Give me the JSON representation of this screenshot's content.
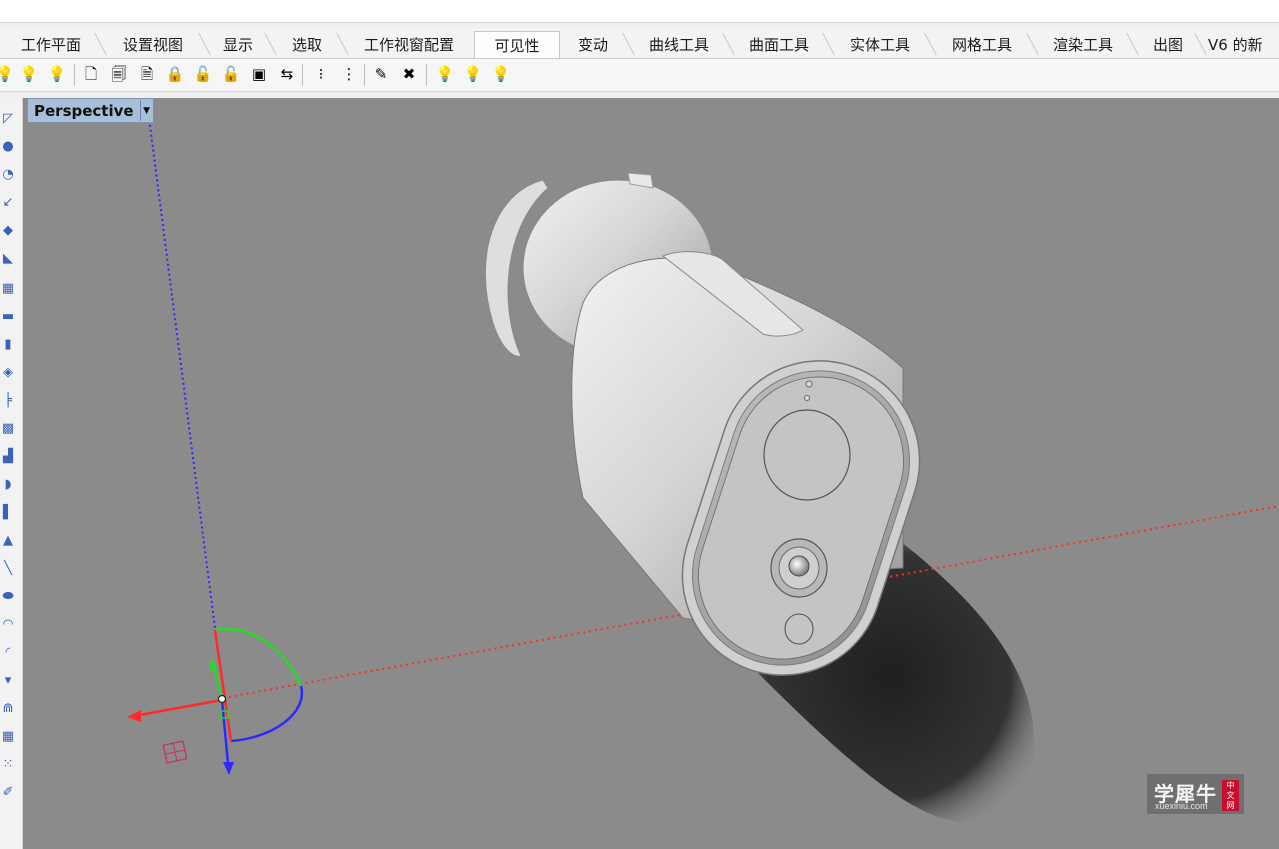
{
  "tabs": [
    {
      "label": "工作平面"
    },
    {
      "label": "设置视图"
    },
    {
      "label": "显示"
    },
    {
      "label": "选取"
    },
    {
      "label": "工作视窗配置"
    },
    {
      "label": "可见性",
      "active": true
    },
    {
      "label": "变动"
    },
    {
      "label": "曲线工具"
    },
    {
      "label": "曲面工具"
    },
    {
      "label": "实体工具"
    },
    {
      "label": "网格工具"
    },
    {
      "label": "渲染工具"
    },
    {
      "label": "出图"
    },
    {
      "label": "V6 的新"
    }
  ],
  "toolbar_icons": [
    "show-light-icon",
    "show-selected-light-icon",
    "hide-light-icon",
    "lock-object-icon",
    "lock-selected-icon",
    "unlock-selected-icon",
    "padlock-icon",
    "padlock-open-icon",
    "padlock-partial-icon",
    "lock-swap-icon",
    "swap-visibility-icon",
    "show-points-icon",
    "hide-points-icon",
    "show-edges-icon",
    "hide-edges-icon",
    "lightbulb-on-icon",
    "lightbulb-selected-icon",
    "lightbulb-off-icon"
  ],
  "left_tools": [
    "point-icon",
    "circle-icon",
    "arc-icon",
    "curve-icon",
    "polyline-icon",
    "line-icon",
    "rectangle-icon",
    "polygon-icon",
    "surface-icon",
    "extrude-icon",
    "loft-icon",
    "patch-icon",
    "box-icon",
    "sphere-icon",
    "cylinder-icon",
    "cone-icon",
    "pipe-icon",
    "ellipsoid-icon",
    "torus-icon",
    "boolean-icon",
    "fillet-icon",
    "mesh-icon",
    "grid-icon",
    "analysis-icon"
  ],
  "viewport": {
    "title": "Perspective",
    "background": "#8b8b8b"
  },
  "colors": {
    "x_axis": "#ff2a2a",
    "y_axis": "#22dd22",
    "z_axis": "#2a2aff",
    "viewport_label_bg": "#a7bfd8"
  },
  "watermark": {
    "main": "学犀牛",
    "sub": "xuexiniu.com",
    "badge": [
      "中",
      "文",
      "网"
    ]
  }
}
